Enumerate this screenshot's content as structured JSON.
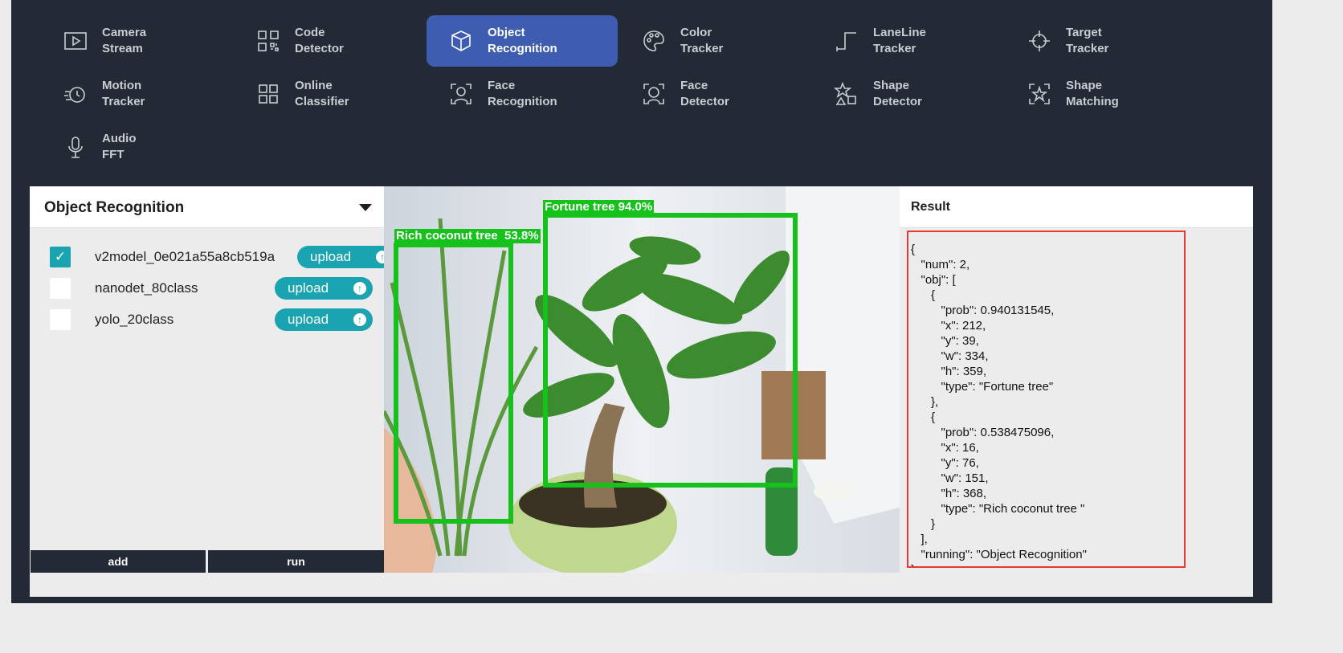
{
  "nav": {
    "items": [
      {
        "label": "Camera\nStream",
        "icon": "play-icon"
      },
      {
        "label": "Code\nDetector",
        "icon": "qr-code-icon"
      },
      {
        "label": "Object\nRecognition",
        "icon": "cube-icon"
      },
      {
        "label": "Color\nTracker",
        "icon": "palette-icon"
      },
      {
        "label": "LaneLine\nTracker",
        "icon": "lane-line-icon"
      },
      {
        "label": "Target\nTracker",
        "icon": "crosshair-icon"
      },
      {
        "label": "Motion\nTracker",
        "icon": "motion-icon"
      },
      {
        "label": "Online\nClassifier",
        "icon": "grid-icon"
      },
      {
        "label": "Face\nRecognition",
        "icon": "face-recognition-icon"
      },
      {
        "label": "Face\nDetector",
        "icon": "face-detector-icon"
      },
      {
        "label": "Shape\nDetector",
        "icon": "shapes-icon"
      },
      {
        "label": "Shape\nMatching",
        "icon": "shape-match-icon"
      },
      {
        "label": "Audio\nFFT",
        "icon": "microphone-icon"
      }
    ],
    "active": "Object\nRecognition"
  },
  "left_panel": {
    "title": "Object Recognition",
    "models": [
      {
        "name": "v2model_0e021a55a8cb519a",
        "checked": true,
        "upload_label": "upload"
      },
      {
        "name": "nanodet_80class",
        "checked": false,
        "upload_label": "upload"
      },
      {
        "name": "yolo_20class",
        "checked": false,
        "upload_label": "upload"
      }
    ],
    "checkmark": "✓",
    "add_label": "add",
    "run_label": "run"
  },
  "camera": {
    "detections": [
      {
        "label": "Fortune tree 94.0%"
      },
      {
        "label": "Rich coconut tree  53.8%"
      }
    ]
  },
  "result": {
    "title": "Result",
    "json": "{\n   \"num\": 2,\n   \"obj\": [\n      {\n         \"prob\": 0.940131545,\n         \"x\": 212,\n         \"y\": 39,\n         \"w\": 334,\n         \"h\": 359,\n         \"type\": \"Fortune tree\"\n      },\n      {\n         \"prob\": 0.538475096,\n         \"x\": 16,\n         \"y\": 76,\n         \"w\": 151,\n         \"h\": 368,\n         \"type\": \"Rich coconut tree \"\n      }\n   ],\n   \"running\": \"Object Recognition\"\n}"
  },
  "colors": {
    "nav_bg": "#232a35",
    "active_bg": "#3f5db0",
    "accent_teal": "#1aa3b0",
    "detection_green": "#16c11c",
    "result_border": "#e53935"
  }
}
